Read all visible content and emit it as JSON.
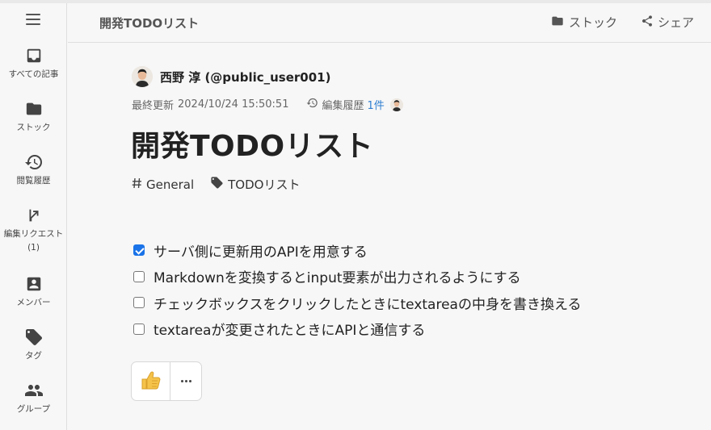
{
  "sidebar": {
    "menu_icon": "hamburger-menu-icon",
    "items": [
      {
        "label": "すべての記事",
        "icon": "inbox-icon"
      },
      {
        "label": "ストック",
        "icon": "folder-icon"
      },
      {
        "label": "閲覧履歴",
        "icon": "history-icon"
      },
      {
        "label": "編集リクエスト\n(1)",
        "icon": "merge-arrow-icon"
      },
      {
        "label": "メンバー",
        "icon": "member-card-icon"
      },
      {
        "label": "タグ",
        "icon": "tag-icon"
      },
      {
        "label": "グループ",
        "icon": "group-icon"
      }
    ]
  },
  "header": {
    "title": "開発TODOリスト",
    "stock_label": "ストック",
    "share_label": "シェア"
  },
  "article": {
    "author": "西野 淳 (@public_user001)",
    "last_updated_label": "最終更新",
    "last_updated": "2024/10/24 15:50:51",
    "history_label": "編集履歴",
    "history_count": "1件",
    "title": "開発TODOリスト",
    "tags": [
      {
        "label": "General",
        "icon": "hash-icon"
      },
      {
        "label": "TODOリスト",
        "icon": "tag-icon"
      }
    ],
    "todos": [
      {
        "text": "サーバ側に更新用のAPIを用意する",
        "checked": true
      },
      {
        "text": "Markdownを変換するとinput要素が出力されるようにする",
        "checked": false
      },
      {
        "text": "チェックボックスをクリックしたときにtextareaの中身を書き換える",
        "checked": false
      },
      {
        "text": "textareaが変更されたときにAPIと通信する",
        "checked": false
      }
    ],
    "reaction_icon": "thumbs-up-icon",
    "more_icon": "more-dots-icon"
  },
  "colors": {
    "accent": "#1a73e8",
    "link": "#2f7fd0",
    "background": "#f7f7f7",
    "thumbs": "#f5c34a"
  }
}
